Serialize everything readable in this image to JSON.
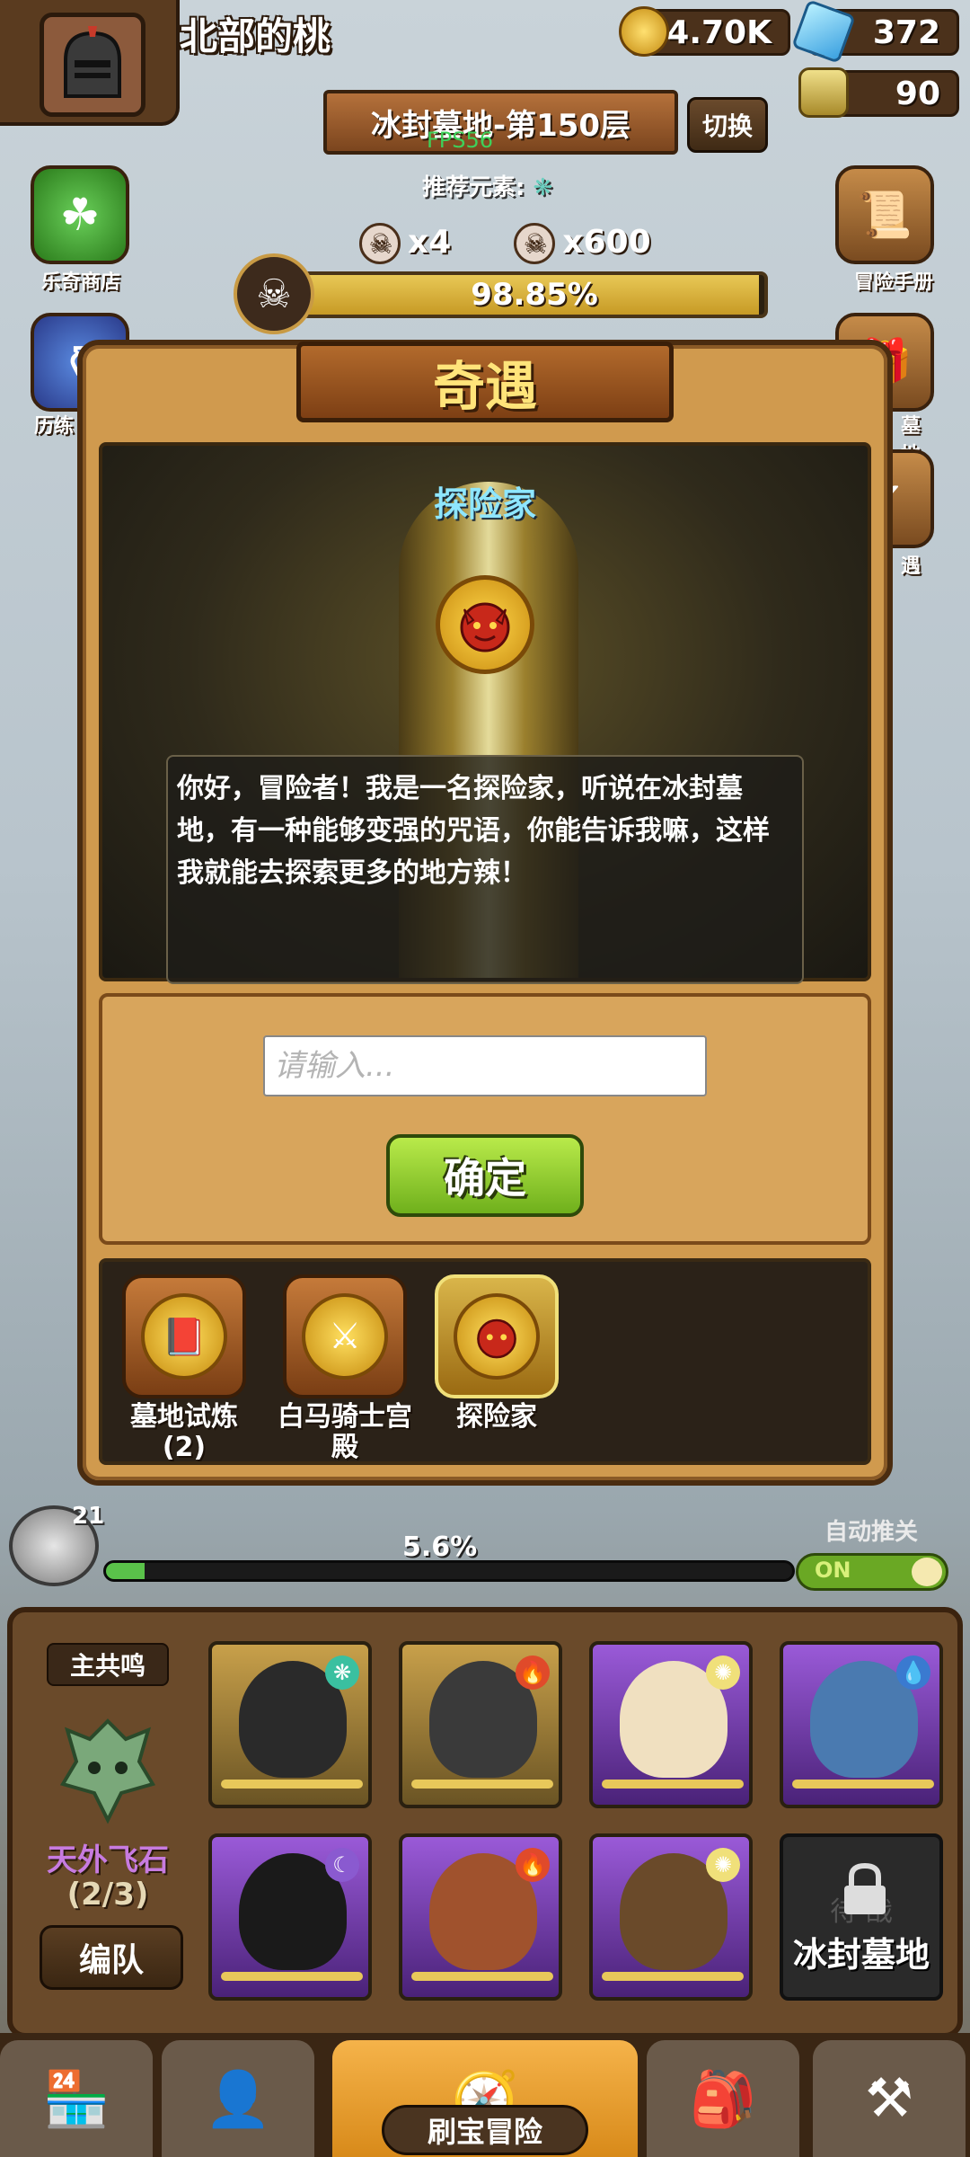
{
  "player": {
    "name": "北部的桃",
    "avatar_icon": "knight-helmet-icon"
  },
  "resources": {
    "gold": "94.70K",
    "gems": "372",
    "potion": "90"
  },
  "stage": {
    "title": "冰封墓地-第150层",
    "fps": "FPS56",
    "switch_label": "切换",
    "recommend_label": "推荐元素:"
  },
  "counters": {
    "kills_small": "x4",
    "kills_large": "x600"
  },
  "boss": {
    "progress_text": "98.85%",
    "progress_value": 0.9885
  },
  "side_buttons": {
    "left_top": "乐奇商店",
    "left_mid": "历练",
    "right_top": "冒险手册",
    "right_mid": "墓地",
    "right_low": "遇"
  },
  "modal": {
    "title": "奇遇",
    "npc_name": "探险家",
    "dialog": "你好，冒险者！我是一名探险家，听说在冰封墓地，有一种能够变强的咒语，你能告诉我嘛，这样我就能去探索更多的地方辣！",
    "input_placeholder": "请输入...",
    "confirm_label": "确定",
    "events": [
      {
        "label": "墓地试炼\n(2)",
        "icon": "book-medal-icon",
        "active": false
      },
      {
        "label": "白马骑士宫殿",
        "icon": "knight-medal-icon",
        "active": false
      },
      {
        "label": "探险家",
        "icon": "demon-medal-icon",
        "active": true
      }
    ]
  },
  "progress": {
    "chest_count": "21",
    "percent_text": "5.6%",
    "percent_value": 0.056,
    "auto_label": "自动推关",
    "toggle_label": "ON"
  },
  "team": {
    "lead_tag": "主共鸣",
    "lead_name": "天外飞石",
    "lead_count": "(2/3)",
    "team_button": "编队",
    "locked_slot_text": "冰封墓地",
    "locked_slot_ghost": "待 战"
  },
  "nav": {
    "active_label": "刷宝冒险"
  }
}
